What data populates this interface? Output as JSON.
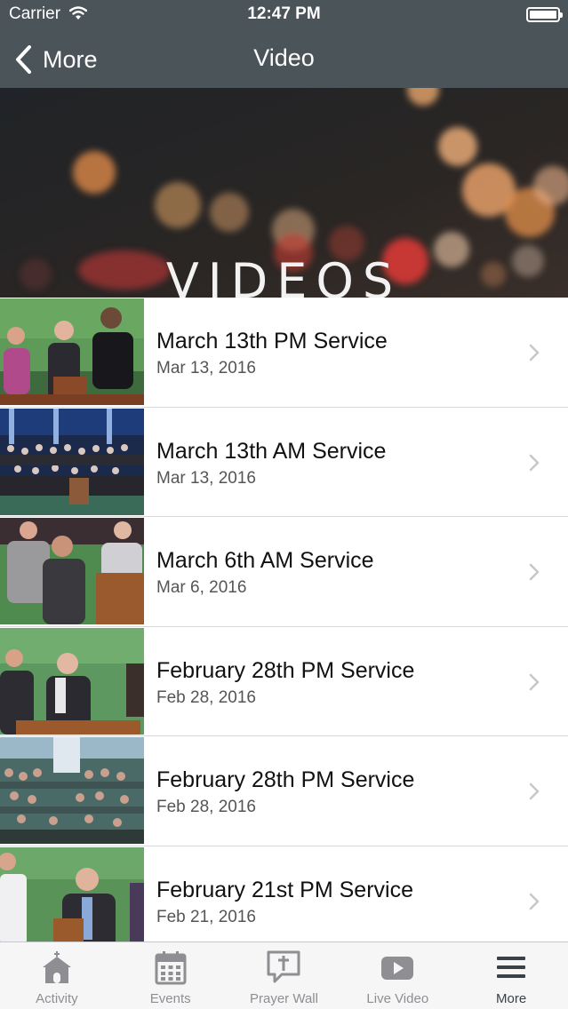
{
  "status_bar": {
    "carrier": "Carrier",
    "time": "12:47 PM"
  },
  "nav": {
    "back_label": "More",
    "title": "Video"
  },
  "banner": {
    "title": "VIDEOS"
  },
  "videos": [
    {
      "title": "March 13th PM Service",
      "date": "Mar 13, 2016"
    },
    {
      "title": "March 13th AM Service",
      "date": "Mar 13, 2016"
    },
    {
      "title": "March 6th AM Service",
      "date": "Mar 6, 2016"
    },
    {
      "title": "February 28th PM Service",
      "date": "Feb 28, 2016"
    },
    {
      "title": "February 28th PM Service",
      "date": "Feb 28, 2016"
    },
    {
      "title": "February 21st PM Service",
      "date": "Feb 21, 2016"
    }
  ],
  "tabs": [
    {
      "label": "Activity",
      "icon": "church-icon"
    },
    {
      "label": "Events",
      "icon": "calendar-icon"
    },
    {
      "label": "Prayer Wall",
      "icon": "prayer-speech-icon"
    },
    {
      "label": "Live Video",
      "icon": "play-video-icon"
    },
    {
      "label": "More",
      "icon": "menu-icon"
    }
  ],
  "colors": {
    "nav_bg": "#4a5459",
    "tab_active": "#3a4247",
    "tab_inactive": "#8e8e93"
  }
}
